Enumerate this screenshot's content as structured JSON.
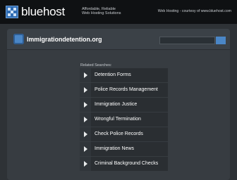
{
  "topbar": {
    "logo_text": "bluehost",
    "tagline": [
      "Affordable, Reliable",
      "Web Hosting Solutions"
    ],
    "sponsor": "Web Hosting - courtesy of www.bluehost.com"
  },
  "header": {
    "site_title": "Immigrationdetention.org",
    "search": {
      "value": "",
      "placeholder": ""
    }
  },
  "related": {
    "title": "Related Searches:",
    "items": [
      "Detention Forms",
      "Police Records Management",
      "Immigration Justice",
      "Wrongful Termination",
      "Check Police Records",
      "Immigration News",
      "Criminal Background Checks"
    ]
  },
  "colors": {
    "page_bg": "#2e3236",
    "topbar_bg": "#0f1113",
    "accent": "#4a86c6",
    "result_bg": "#2a2e32"
  }
}
